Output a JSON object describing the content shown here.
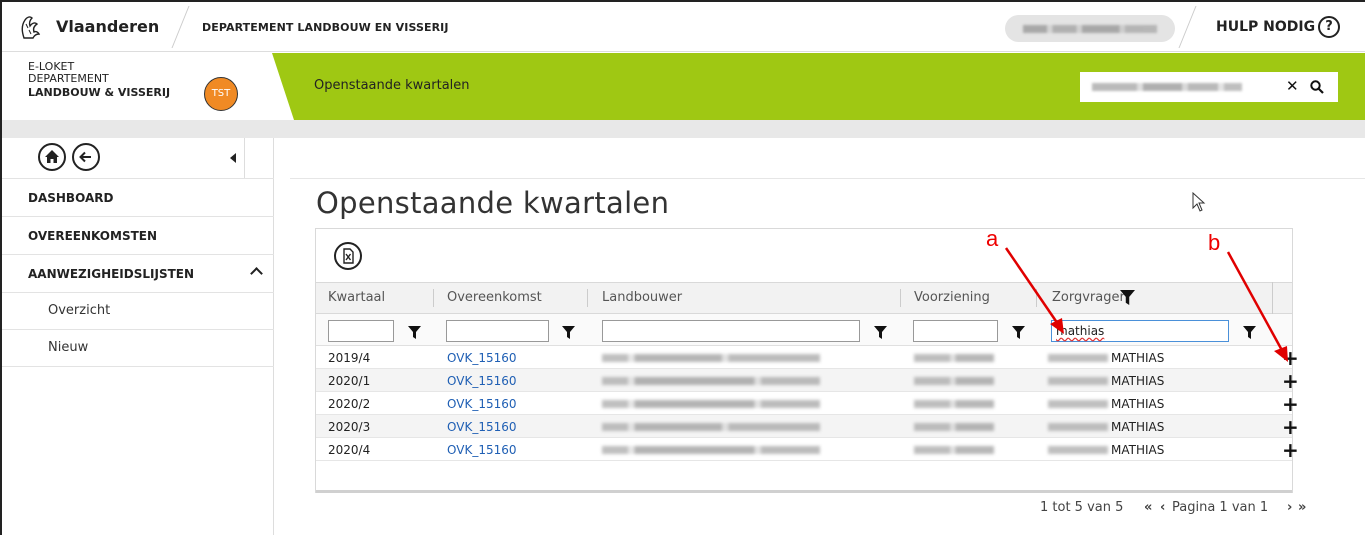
{
  "topbar": {
    "brand": "Vlaanderen",
    "department": "DEPARTEMENT LANDBOUW EN VISSERIJ",
    "help_label": "HULP NODIG",
    "help_icon_glyph": "?"
  },
  "header": {
    "loket_line1": "E-LOKET",
    "loket_line2": "DEPARTEMENT",
    "loket_line3": "LANDBOUW & VISSERIJ",
    "env_badge": "TST",
    "breadcrumb": "Openstaande kwartalen",
    "search_clear_glyph": "✕"
  },
  "sidebar": {
    "items": [
      {
        "label": "DASHBOARD"
      },
      {
        "label": "OVEREENKOMSTEN"
      },
      {
        "label": "AANWEZIGHEIDSLIJSTEN"
      }
    ],
    "subitems": [
      {
        "label": "Overzicht"
      },
      {
        "label": "Nieuw"
      }
    ]
  },
  "main": {
    "title": "Openstaande kwartalen"
  },
  "table": {
    "columns": [
      "Kwartaal",
      "Overeenkomst",
      "Landbouwer",
      "Voorziening",
      "Zorgvrager"
    ],
    "filters": {
      "kwartaal": "",
      "overeenkomst": "",
      "landbouwer": "",
      "voorziening": "",
      "zorgvrager": "mathias"
    },
    "rows": [
      {
        "kwartaal": "2019/4",
        "overeenkomst": "OVK_15160",
        "zorgvrager": "MATHIAS"
      },
      {
        "kwartaal": "2020/1",
        "overeenkomst": "OVK_15160",
        "zorgvrager": "MATHIAS"
      },
      {
        "kwartaal": "2020/2",
        "overeenkomst": "OVK_15160",
        "zorgvrager": "MATHIAS"
      },
      {
        "kwartaal": "2020/3",
        "overeenkomst": "OVK_15160",
        "zorgvrager": "MATHIAS"
      },
      {
        "kwartaal": "2020/4",
        "overeenkomst": "OVK_15160",
        "zorgvrager": "MATHIAS"
      }
    ],
    "add_glyph": "+"
  },
  "pager": {
    "summary": "1 tot 5 van 5",
    "page_label": "Pagina 1 van 1",
    "first_glyph": "«",
    "prev_glyph": "‹",
    "next_glyph": "›",
    "last_glyph": "»"
  },
  "annotations": {
    "label_a": "a",
    "label_b": "b",
    "color": "#e00000"
  },
  "colors": {
    "accent_green": "#9fc813",
    "badge_orange": "#f08a24",
    "link_blue": "#1f5fb4"
  }
}
